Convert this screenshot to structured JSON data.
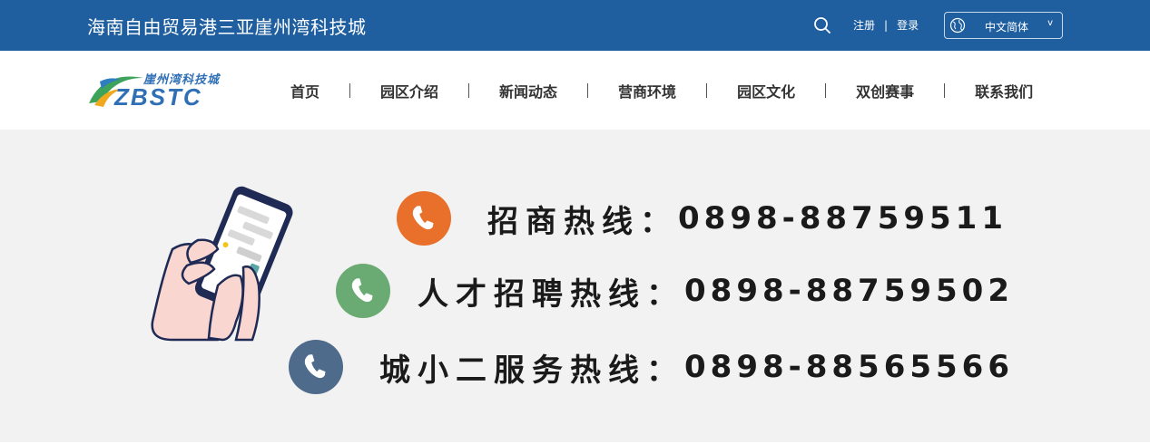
{
  "header": {
    "site_title": "海南自由贸易港三亚崖州湾科技城",
    "register_label": "注册",
    "separator": "|",
    "login_label": "登录",
    "language": {
      "selected": "中文简体",
      "chevron": "v"
    }
  },
  "logo": {
    "text_cn": "崖州湾科技城",
    "text_en": "ZBSTC"
  },
  "nav": {
    "separator": "|",
    "items": [
      {
        "label": "首页"
      },
      {
        "label": "园区介绍"
      },
      {
        "label": "新闻动态"
      },
      {
        "label": "营商环境"
      },
      {
        "label": "园区文化"
      },
      {
        "label": "双创赛事"
      },
      {
        "label": "联系我们"
      }
    ]
  },
  "hotlines": [
    {
      "label": "招商热线：",
      "number": "0898-88759511",
      "color": "#e8702a"
    },
    {
      "label": "人才招聘热线：",
      "number": "0898-88759502",
      "color": "#6aab73"
    },
    {
      "label": "城小二服务热线：",
      "number": "0898-88565566",
      "color": "#4f6b8c"
    }
  ],
  "colors": {
    "header_bg": "#1f5f9f",
    "main_bg": "#f2f2f2"
  }
}
